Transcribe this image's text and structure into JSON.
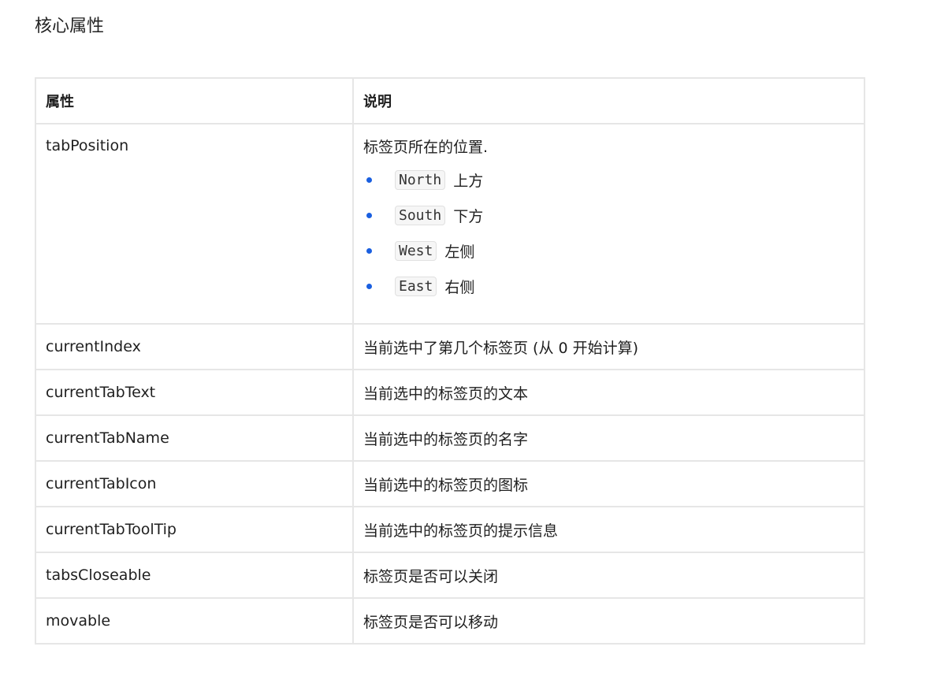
{
  "heading": "核心属性",
  "table": {
    "headers": [
      "属性",
      "说明"
    ],
    "tab_position": {
      "name": "tabPosition",
      "intro": "标签页所在的位置.",
      "options": [
        {
          "code": "North",
          "label": "上方"
        },
        {
          "code": "South",
          "label": "下方"
        },
        {
          "code": "West",
          "label": "左侧"
        },
        {
          "code": "East",
          "label": "右侧"
        }
      ]
    },
    "rows": [
      {
        "name": "currentIndex",
        "desc": "当前选中了第几个标签页 (从 0 开始计算)"
      },
      {
        "name": "currentTabText",
        "desc": "当前选中的标签页的文本"
      },
      {
        "name": "currentTabName",
        "desc": "当前选中的标签页的名字"
      },
      {
        "name": "currentTabIcon",
        "desc": "当前选中的标签页的图标"
      },
      {
        "name": "currentTabToolTip",
        "desc": "当前选中的标签页的提示信息"
      },
      {
        "name": "tabsCloseable",
        "desc": "标签页是否可以关闭"
      },
      {
        "name": "movable",
        "desc": "标签页是否可以移动"
      }
    ]
  },
  "colors": {
    "bullet": "#1a5fe0",
    "border": "#e6e6e6"
  }
}
